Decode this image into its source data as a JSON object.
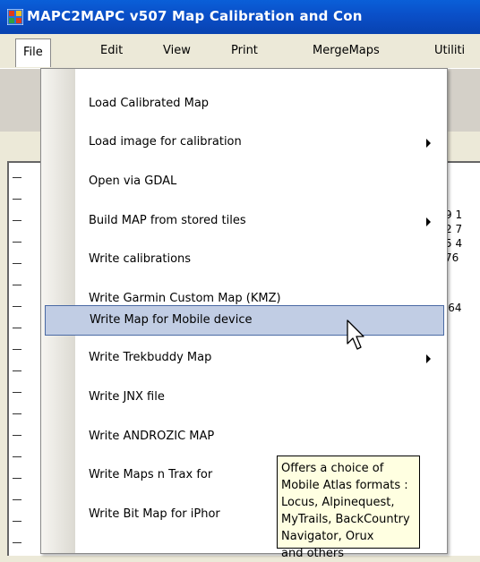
{
  "window": {
    "title": "MAPC2MAPC  v507 Map Calibration and Con",
    "icon": "app-icon"
  },
  "menubar": {
    "items": [
      "File",
      "Edit",
      "View",
      "Print",
      "MergeMaps",
      "Utiliti"
    ],
    "active": "File"
  },
  "file_menu": {
    "items": [
      {
        "label": "Load Calibrated Map",
        "submenu": false
      },
      {
        "label": "Load image for calibration",
        "submenu": true
      },
      {
        "label": "Open via GDAL",
        "submenu": false
      },
      {
        "label": "Build MAP from stored tiles",
        "submenu": true
      },
      {
        "label": "Write calibrations",
        "submenu": false
      },
      {
        "label": "Write Garmin Custom Map (KMZ)",
        "submenu": false
      },
      {
        "label": "Write Map for Mobile device",
        "submenu": false,
        "highlighted": true
      },
      {
        "label": "Write Trekbuddy Map",
        "submenu": true
      },
      {
        "label": "Write JNX file",
        "submenu": false
      },
      {
        "label": "Write ANDROZIC MAP",
        "submenu": false
      },
      {
        "label": "Write Maps n Trax for",
        "submenu": false
      },
      {
        "label": "Write Bit Map for iPhor",
        "submenu": false
      }
    ]
  },
  "tooltip": {
    "lines": [
      "Offers a choice of",
      "Mobile Atlas formats :",
      "Locus, Alpinequest,",
      "MyTrails, BackCountry",
      "Navigator, Orux",
      "and others"
    ]
  },
  "background": {
    "numbers": [
      "9 1",
      "2 7",
      "5 4",
      "76",
      "",
      "",
      "'64"
    ]
  },
  "colors": {
    "titlebar": "#0a50c8",
    "menu_highlight": "#c1cde4",
    "menu_highlight_border": "#4a6aa4",
    "tooltip_bg": "#ffffe1"
  }
}
